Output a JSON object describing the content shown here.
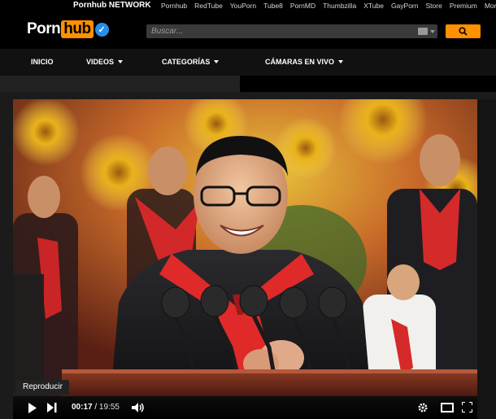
{
  "network": {
    "brand": "Pornhub NETWORK",
    "links": [
      "Pornhub",
      "RedTube",
      "YouPorn",
      "Tube8",
      "PornMD",
      "Thumbzilla",
      "XTube",
      "GayPorn",
      "Store",
      "Premium",
      "More"
    ]
  },
  "header": {
    "logo_part1": "Porn",
    "logo_part2": "hub",
    "search_placeholder": "Buscar..."
  },
  "nav": {
    "items": [
      "INICIO",
      "VIDEOS",
      "CATEGORÍAS",
      "CÁMARAS EN VIVO"
    ]
  },
  "player": {
    "tooltip": "Reproducir",
    "current_time": "00:17",
    "total_time": "19:55"
  },
  "colors": {
    "accent": "#ff9000",
    "verified": "#2a8ee8"
  },
  "icons": [
    "search-icon",
    "camera-icon",
    "play-icon",
    "next-icon",
    "volume-icon",
    "settings-icon",
    "theater-icon",
    "fullscreen-icon",
    "verified-icon"
  ]
}
